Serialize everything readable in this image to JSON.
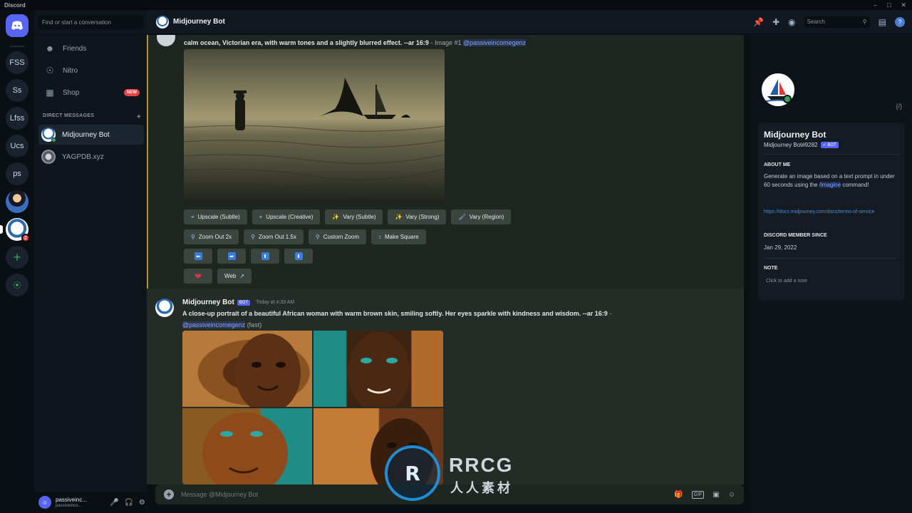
{
  "app": {
    "title": "Discord"
  },
  "rail": {
    "servers": [
      "FSS",
      "Ss",
      "Lfss",
      "Ucs",
      "ps"
    ],
    "badge_count": "2"
  },
  "dm_sidebar": {
    "search_placeholder": "Find or start a conversation",
    "nav": [
      {
        "label": "Friends",
        "icon": "friends-icon"
      },
      {
        "label": "Nitro",
        "icon": "nitro-icon"
      },
      {
        "label": "Shop",
        "icon": "shop-icon",
        "badge": "NEW"
      }
    ],
    "dm_header": "DIRECT MESSAGES",
    "dms": [
      {
        "name": "Midjourney Bot"
      },
      {
        "name": "YAGPDB.xyz"
      }
    ],
    "user": {
      "name": "passiveinc...",
      "sub": "passiveinco..."
    }
  },
  "header": {
    "title": "Midjourney Bot",
    "search_placeholder": "Search"
  },
  "chat": {
    "msg1": {
      "text_line": "calm ocean, Victorian era, with warm tones and a slightly blurred effect. --ar 16:9",
      "suffix": " - Image #1 ",
      "mention": "@passiveincomegenz"
    },
    "buttons_row1": [
      {
        "label": "Upscale (Subtle)",
        "icon": "expand-icon"
      },
      {
        "label": "Upscale (Creative)",
        "icon": "expand-icon"
      },
      {
        "label": "Vary (Subtle)",
        "icon": "sparkle-icon"
      },
      {
        "label": "Vary (Strong)",
        "icon": "sparkle-icon"
      },
      {
        "label": "Vary (Region)",
        "icon": "brush-icon"
      }
    ],
    "buttons_row2": [
      {
        "label": "Zoom Out 2x",
        "icon": "magnifier-icon"
      },
      {
        "label": "Zoom Out 1.5x",
        "icon": "magnifier-icon"
      },
      {
        "label": "Custom Zoom",
        "icon": "magnifier-icon"
      },
      {
        "label": "Make Square",
        "icon": "updown-arrow-icon"
      }
    ],
    "arrows": [
      "⬅",
      "➡",
      "⬆",
      "⬇"
    ],
    "web_label": "Web",
    "msg2": {
      "author": "Midjourney Bot",
      "bot_tag": "BOT",
      "time": "Today at 4:33 AM",
      "text": "A close-up portrait of a beautiful African woman with warm brown skin, smiling softly. Her eyes sparkle with kindness and wisdom. --ar 16:9",
      "dash": " -",
      "mention": "@passiveincomegenz",
      "suffix": " (fast)"
    },
    "input_placeholder": "Message @Midjourney Bot"
  },
  "profile": {
    "name": "Midjourney Bot",
    "tag": "Midjourney Bot#9282",
    "bot_tag": "BOT",
    "about_head": "ABOUT ME",
    "about_pre": "Generate an image based on a text prompt in under 60 seconds using the ",
    "about_cmd": "/imagine",
    "about_post": " command!",
    "link": "https://docs.midjourney.com/docs/terms-of-service",
    "member_head": "DISCORD MEMBER SINCE",
    "member_date": "Jan 29, 2022",
    "note_head": "NOTE",
    "note_placeholder": "Click to add a note"
  },
  "watermark": {
    "line1": "RRCG",
    "line2": "人人素材"
  },
  "colors": {
    "accent": "#5865f2",
    "online": "#3ba55c",
    "badge": "#ed4245"
  }
}
